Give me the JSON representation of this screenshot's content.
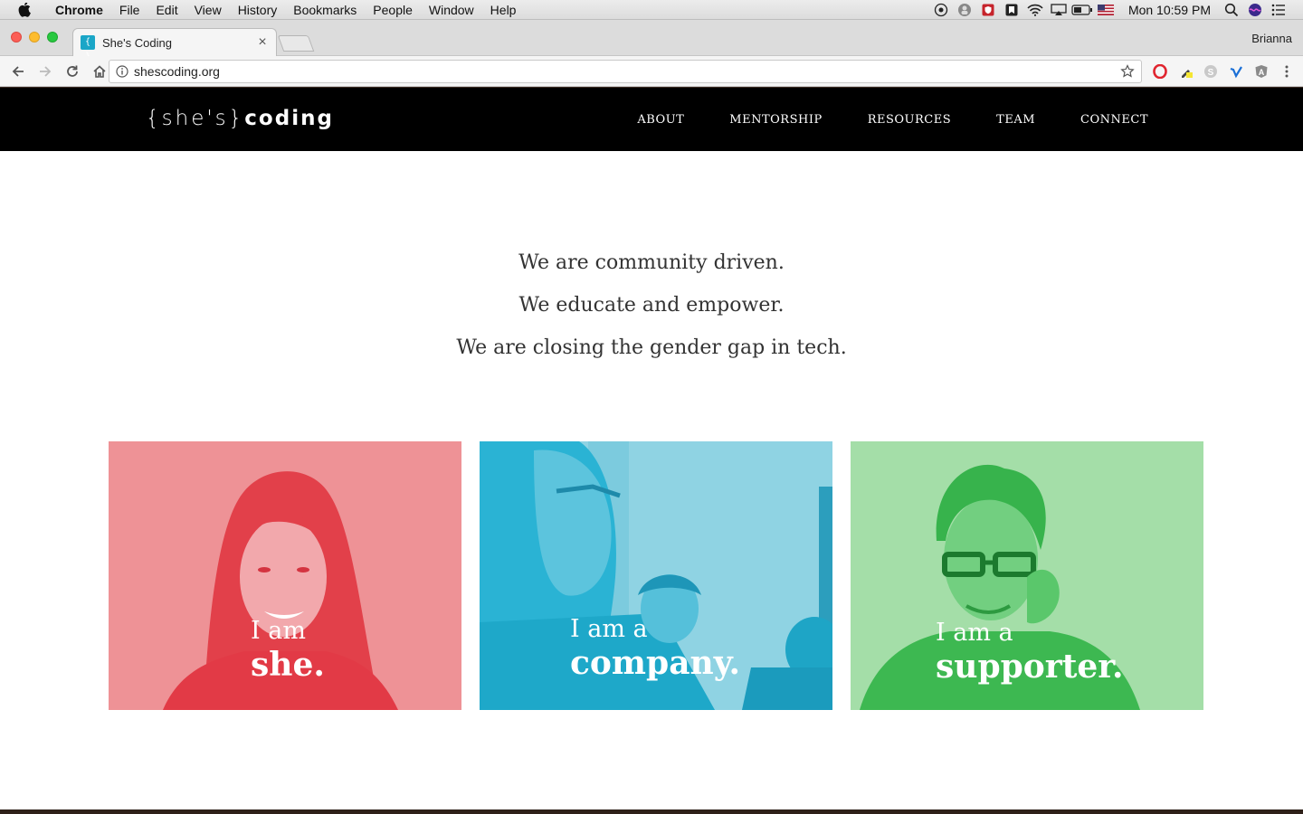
{
  "menubar": {
    "app": "Chrome",
    "items": [
      "File",
      "Edit",
      "View",
      "History",
      "Bookmarks",
      "People",
      "Window",
      "Help"
    ],
    "clock": "Mon 10:59 PM"
  },
  "browser": {
    "tab_title": "She's Coding",
    "tab_favicon": "{ }",
    "profile": "Brianna",
    "url": "shescoding.org"
  },
  "site": {
    "logo_light": "{she's}",
    "logo_bold": "coding",
    "nav": [
      "ABOUT",
      "MENTORSHIP",
      "RESOURCES",
      "TEAM",
      "CONNECT"
    ],
    "tagline": [
      "We are community driven.",
      "We educate and empower.",
      "We are closing the gender gap in tech."
    ],
    "cards": [
      {
        "line1": "I am",
        "line2": "she.",
        "color": "#ef6b75"
      },
      {
        "line1": "I am a",
        "line2": "company.",
        "color": "#2ab6d6"
      },
      {
        "line1": "I am a",
        "line2": "supporter.",
        "color": "#4ac863"
      }
    ]
  },
  "colors": {
    "nav_bg": "#000000",
    "page_bg": "#ffffff",
    "tab_favicon": "#1aa6c7"
  }
}
